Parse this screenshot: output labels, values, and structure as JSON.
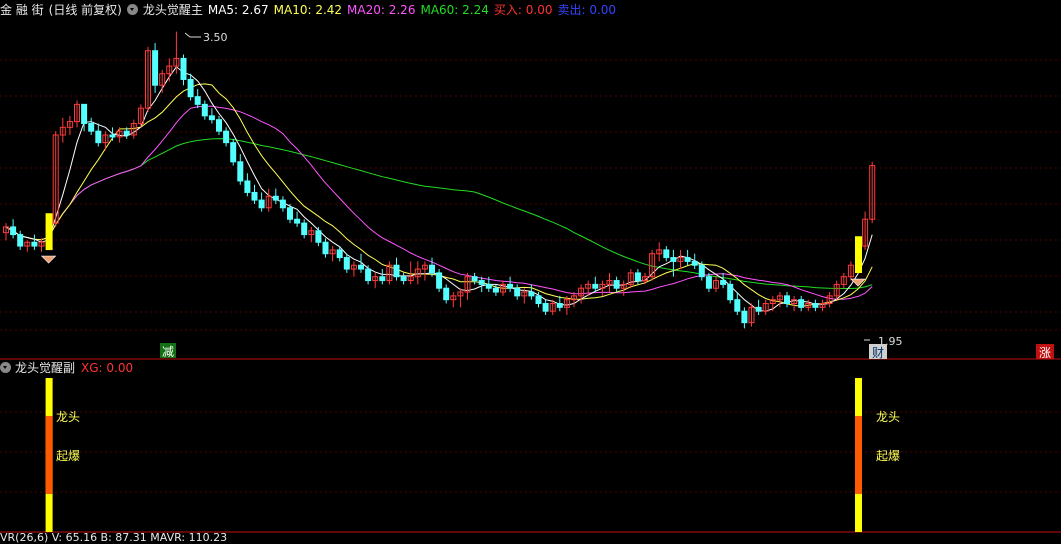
{
  "header": {
    "stock_name": "金 融 街",
    "period": "(日线 前复权)",
    "indicator": "龙头觉醒主",
    "ma5": "MA5: 2.67",
    "ma10": "MA10: 2.42",
    "ma20": "MA20: 2.26",
    "ma60": "MA60: 2.24",
    "buy": "买入: 0.00",
    "sell": "卖出: 0.00"
  },
  "sub_header": {
    "indicator": "龙头觉醒副",
    "xg": "XG: 0.00"
  },
  "footer": {
    "text": "VR(26,6) V: 65.16 B: 87.31 MAVR: 110.23"
  },
  "main_chart": {
    "high_label": "3.50",
    "low_label": "1.95",
    "markers": {
      "reduce": "减",
      "wealth": "财",
      "rise": "涨"
    }
  },
  "sub_chart": {
    "label_longtou": "龙头",
    "label_qibao": "起爆"
  },
  "colors": {
    "up": "#ff3b3b",
    "down": "#54ffff",
    "ma5": "#ffffff",
    "ma10": "#ffff55",
    "ma20": "#ff55ff",
    "ma60": "#22dd22",
    "signal_yellow": "#ffff00",
    "signal_orange": "#ff5a00"
  },
  "chart_data": {
    "type": "candlestick",
    "y_range": [
      1.9,
      3.55
    ],
    "candles": [
      [
        2.45,
        2.5,
        2.41,
        2.48
      ],
      [
        2.48,
        2.52,
        2.42,
        2.44
      ],
      [
        2.44,
        2.46,
        2.36,
        2.38
      ],
      [
        2.38,
        2.41,
        2.35,
        2.4
      ],
      [
        2.4,
        2.44,
        2.36,
        2.38
      ],
      [
        2.38,
        2.42,
        2.35,
        2.4
      ],
      [
        2.4,
        2.52,
        2.38,
        2.5
      ],
      [
        2.5,
        2.98,
        2.48,
        2.96
      ],
      [
        2.96,
        3.05,
        2.92,
        3.0
      ],
      [
        3.0,
        3.06,
        2.96,
        3.03
      ],
      [
        3.03,
        3.14,
        3.0,
        3.12
      ],
      [
        3.12,
        3.12,
        2.98,
        3.02
      ],
      [
        3.02,
        3.05,
        2.96,
        2.98
      ],
      [
        2.98,
        3.02,
        2.9,
        2.92
      ],
      [
        2.92,
        2.98,
        2.88,
        2.96
      ],
      [
        2.96,
        3.0,
        2.93,
        2.95
      ],
      [
        2.95,
        3.0,
        2.92,
        2.98
      ],
      [
        2.98,
        3.0,
        2.94,
        2.96
      ],
      [
        2.96,
        3.04,
        2.94,
        3.02
      ],
      [
        3.02,
        3.12,
        3.0,
        3.1
      ],
      [
        3.1,
        3.42,
        3.08,
        3.4
      ],
      [
        3.4,
        3.44,
        3.18,
        3.22
      ],
      [
        3.22,
        3.3,
        3.18,
        3.28
      ],
      [
        3.28,
        3.36,
        3.24,
        3.32
      ],
      [
        3.32,
        3.5,
        3.28,
        3.36
      ],
      [
        3.36,
        3.38,
        3.22,
        3.25
      ],
      [
        3.25,
        3.28,
        3.14,
        3.16
      ],
      [
        3.16,
        3.2,
        3.1,
        3.12
      ],
      [
        3.12,
        3.14,
        3.04,
        3.06
      ],
      [
        3.06,
        3.1,
        3.02,
        3.04
      ],
      [
        3.04,
        3.06,
        2.96,
        2.98
      ],
      [
        2.98,
        3.0,
        2.9,
        2.92
      ],
      [
        2.92,
        2.94,
        2.8,
        2.82
      ],
      [
        2.82,
        2.86,
        2.7,
        2.72
      ],
      [
        2.72,
        2.76,
        2.64,
        2.66
      ],
      [
        2.66,
        2.7,
        2.6,
        2.62
      ],
      [
        2.62,
        2.66,
        2.56,
        2.58
      ],
      [
        2.58,
        2.68,
        2.56,
        2.64
      ],
      [
        2.64,
        2.68,
        2.6,
        2.62
      ],
      [
        2.62,
        2.64,
        2.56,
        2.58
      ],
      [
        2.58,
        2.6,
        2.5,
        2.52
      ],
      [
        2.52,
        2.56,
        2.48,
        2.5
      ],
      [
        2.5,
        2.52,
        2.42,
        2.44
      ],
      [
        2.44,
        2.48,
        2.4,
        2.46
      ],
      [
        2.46,
        2.48,
        2.38,
        2.4
      ],
      [
        2.4,
        2.42,
        2.32,
        2.34
      ],
      [
        2.34,
        2.38,
        2.3,
        2.36
      ],
      [
        2.36,
        2.38,
        2.3,
        2.32
      ],
      [
        2.32,
        2.34,
        2.24,
        2.26
      ],
      [
        2.26,
        2.3,
        2.22,
        2.28
      ],
      [
        2.28,
        2.34,
        2.24,
        2.26
      ],
      [
        2.26,
        2.28,
        2.18,
        2.2
      ],
      [
        2.2,
        2.24,
        2.16,
        2.22
      ],
      [
        2.22,
        2.26,
        2.18,
        2.2
      ],
      [
        2.2,
        2.3,
        2.18,
        2.28
      ],
      [
        2.28,
        2.32,
        2.2,
        2.22
      ],
      [
        2.22,
        2.24,
        2.18,
        2.2
      ],
      [
        2.2,
        2.3,
        2.18,
        2.22
      ],
      [
        2.22,
        2.3,
        2.18,
        2.26
      ],
      [
        2.26,
        2.3,
        2.2,
        2.28
      ],
      [
        2.28,
        2.32,
        2.22,
        2.24
      ],
      [
        2.24,
        2.26,
        2.14,
        2.16
      ],
      [
        2.16,
        2.18,
        2.08,
        2.1
      ],
      [
        2.1,
        2.14,
        2.06,
        2.12
      ],
      [
        2.12,
        2.16,
        2.06,
        2.14
      ],
      [
        2.14,
        2.24,
        2.1,
        2.22
      ],
      [
        2.22,
        2.24,
        2.18,
        2.2
      ],
      [
        2.2,
        2.22,
        2.14,
        2.18
      ],
      [
        2.18,
        2.22,
        2.14,
        2.16
      ],
      [
        2.16,
        2.18,
        2.12,
        2.14
      ],
      [
        2.14,
        2.2,
        2.12,
        2.18
      ],
      [
        2.18,
        2.22,
        2.14,
        2.16
      ],
      [
        2.16,
        2.18,
        2.1,
        2.12
      ],
      [
        2.12,
        2.16,
        2.08,
        2.14
      ],
      [
        2.14,
        2.18,
        2.1,
        2.12
      ],
      [
        2.12,
        2.14,
        2.06,
        2.08
      ],
      [
        2.08,
        2.1,
        2.02,
        2.04
      ],
      [
        2.04,
        2.1,
        2.02,
        2.08
      ],
      [
        2.08,
        2.12,
        2.04,
        2.06
      ],
      [
        2.06,
        2.12,
        2.02,
        2.1
      ],
      [
        2.1,
        2.14,
        2.06,
        2.12
      ],
      [
        2.12,
        2.18,
        2.08,
        2.16
      ],
      [
        2.16,
        2.2,
        2.12,
        2.18
      ],
      [
        2.18,
        2.22,
        2.14,
        2.16
      ],
      [
        2.16,
        2.2,
        2.12,
        2.18
      ],
      [
        2.18,
        2.24,
        2.14,
        2.2
      ],
      [
        2.2,
        2.22,
        2.14,
        2.16
      ],
      [
        2.16,
        2.2,
        2.12,
        2.18
      ],
      [
        2.18,
        2.26,
        2.16,
        2.24
      ],
      [
        2.24,
        2.26,
        2.18,
        2.2
      ],
      [
        2.2,
        2.24,
        2.18,
        2.22
      ],
      [
        2.22,
        2.36,
        2.2,
        2.34
      ],
      [
        2.34,
        2.4,
        2.3,
        2.36
      ],
      [
        2.36,
        2.38,
        2.3,
        2.32
      ],
      [
        2.32,
        2.36,
        2.22,
        2.3
      ],
      [
        2.3,
        2.36,
        2.26,
        2.32
      ],
      [
        2.32,
        2.36,
        2.28,
        2.3
      ],
      [
        2.3,
        2.34,
        2.26,
        2.28
      ],
      [
        2.28,
        2.3,
        2.2,
        2.22
      ],
      [
        2.22,
        2.24,
        2.14,
        2.16
      ],
      [
        2.16,
        2.22,
        2.14,
        2.2
      ],
      [
        2.2,
        2.24,
        2.16,
        2.18
      ],
      [
        2.18,
        2.2,
        2.08,
        2.1
      ],
      [
        2.1,
        2.14,
        2.02,
        2.04
      ],
      [
        2.04,
        2.06,
        1.95,
        1.98
      ],
      [
        1.98,
        2.08,
        1.96,
        2.06
      ],
      [
        2.06,
        2.1,
        2.02,
        2.04
      ],
      [
        2.04,
        2.1,
        2.02,
        2.08
      ],
      [
        2.08,
        2.12,
        2.04,
        2.1
      ],
      [
        2.1,
        2.14,
        2.06,
        2.12
      ],
      [
        2.12,
        2.14,
        2.06,
        2.08
      ],
      [
        2.08,
        2.12,
        2.04,
        2.1
      ],
      [
        2.1,
        2.12,
        2.04,
        2.06
      ],
      [
        2.06,
        2.1,
        2.04,
        2.08
      ],
      [
        2.08,
        2.1,
        2.04,
        2.06
      ],
      [
        2.06,
        2.1,
        2.04,
        2.08
      ],
      [
        2.08,
        2.14,
        2.06,
        2.12
      ],
      [
        2.12,
        2.2,
        2.1,
        2.18
      ],
      [
        2.18,
        2.24,
        2.16,
        2.22
      ],
      [
        2.22,
        2.3,
        2.2,
        2.28
      ],
      [
        2.28,
        2.4,
        2.26,
        2.38
      ],
      [
        2.38,
        2.56,
        2.36,
        2.52
      ],
      [
        2.52,
        2.82,
        2.5,
        2.8
      ]
    ],
    "signals": {
      "longtou_qibao": [
        6,
        120
      ],
      "reduce": 21,
      "wealth": 120,
      "rise": 146
    }
  }
}
